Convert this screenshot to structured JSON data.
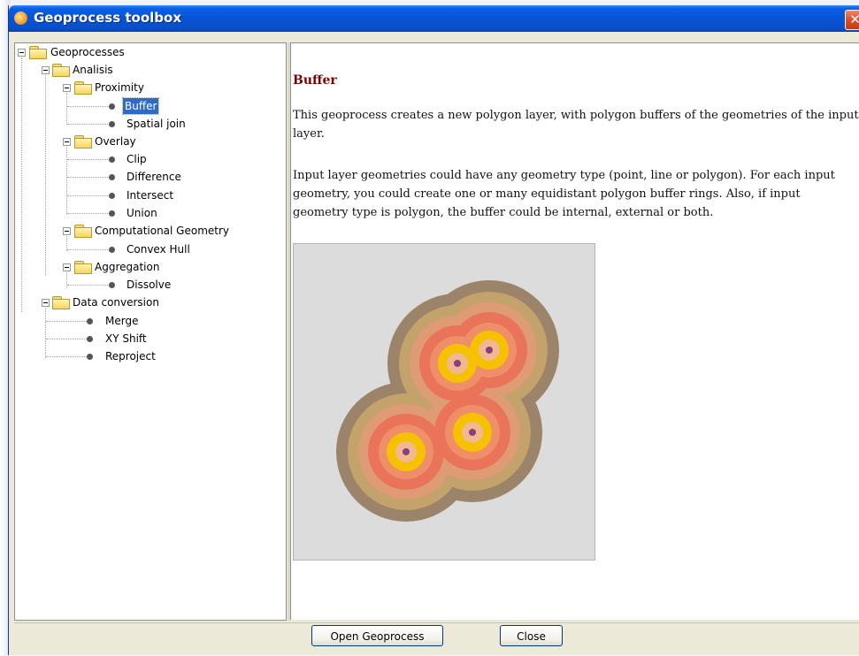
{
  "window": {
    "title": "Geoprocess toolbox",
    "close_glyph": "✕",
    "app_icon": "gvsig-icon"
  },
  "tree": {
    "root": "Geoprocesses",
    "analisis": "Analisis",
    "proximity": "Proximity",
    "buffer": "Buffer",
    "spatial_join": "Spatial join",
    "overlay": "Overlay",
    "clip": "Clip",
    "difference": "Difference",
    "intersect": "Intersect",
    "union": "Union",
    "computational_geometry": "Computational Geometry",
    "convex_hull": "Convex Hull",
    "aggregation": "Aggregation",
    "dissolve": "Dissolve",
    "data_conversion": "Data conversion",
    "merge": "Merge",
    "xy_shift": "XY Shift",
    "reproject": "Reproject",
    "selected": "Buffer"
  },
  "doc": {
    "title": "Buffer",
    "para1": "This geoprocess creates a new polygon layer, with polygon buffers of the geometries of the input layer.",
    "para2": "Input layer geometries could have any geometry type (point, line or polygon). For each input geometry, you could create one or many equidistant polygon buffer rings. Also, if input geometry type is polygon, the buffer could be internal, external or both."
  },
  "illustration": {
    "ring_colors": [
      "#9b8469",
      "#c3a36b",
      "#df9b73",
      "#e9745a",
      "#ee8f6a",
      "#f6c200",
      "#f0b98f"
    ],
    "center_color": "#8b3e7e",
    "background": "#dcdcdc"
  },
  "buttons": {
    "open": "Open Geoprocess",
    "close": "Close"
  }
}
